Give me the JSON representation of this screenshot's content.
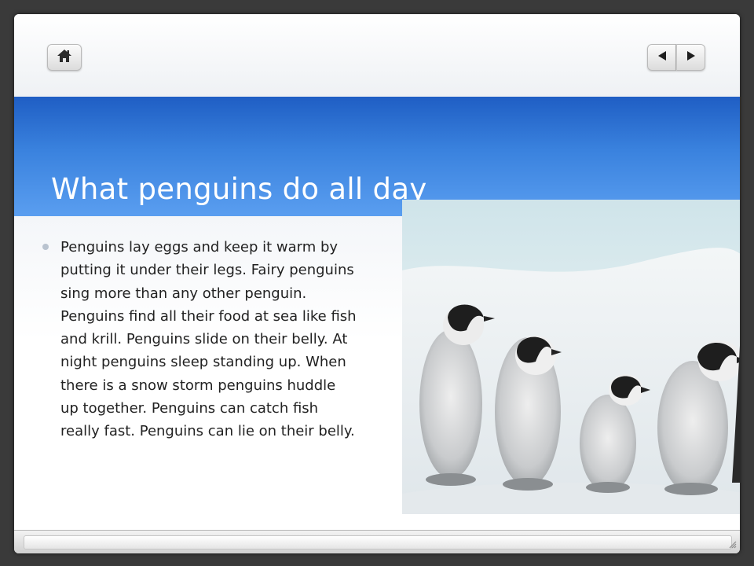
{
  "slide": {
    "title": "What penguins do all day",
    "bullets": [
      "Penguins lay eggs and keep it warm by putting it under their legs. Fairy penguins sing more than any other penguin. Penguins find all their food at sea like fish and krill. Penguins slide on their  belly. At night penguins sleep standing up. When there is a snow storm penguins huddle up together. Penguins can catch fish really fast. Penguins can lie on their belly."
    ],
    "image": {
      "subject": "emperor penguin chicks walking in a row on snow"
    }
  },
  "toolbar": {
    "home_icon": "home-icon",
    "prev_icon": "triangle-left-icon",
    "next_icon": "triangle-right-icon"
  },
  "colors": {
    "title_band": "#2f74d6",
    "title_text": "#ffffff",
    "body_text": "#222222"
  }
}
